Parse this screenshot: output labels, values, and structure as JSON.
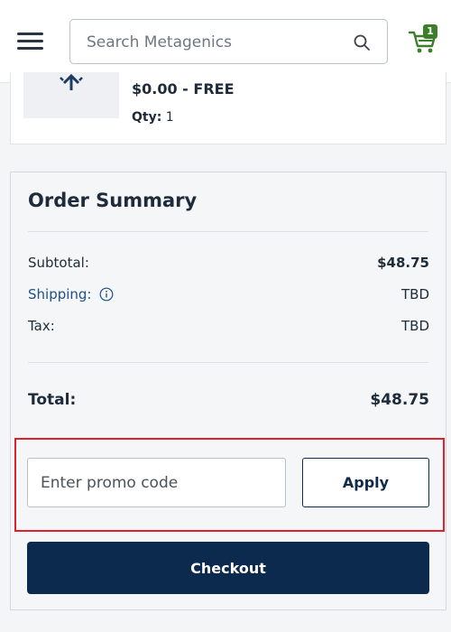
{
  "header": {
    "search_placeholder": "Search Metagenics",
    "cart_count": "1"
  },
  "product": {
    "price": "$0.00 - FREE",
    "qty_label": "Qty:",
    "qty_value": "1"
  },
  "summary": {
    "title": "Order Summary",
    "subtotal_label": "Subtotal:",
    "subtotal_value": "$48.75",
    "shipping_label": "Shipping:",
    "shipping_value": "TBD",
    "tax_label": "Tax:",
    "tax_value": "TBD",
    "total_label": "Total:",
    "total_value": "$48.75"
  },
  "promo": {
    "placeholder": "Enter promo code",
    "apply_label": "Apply"
  },
  "checkout_label": "Checkout",
  "colors": {
    "brand_navy": "#0c2a4d",
    "cart_badge_green": "#3d7e2a",
    "highlight_red": "#e0202a",
    "link_blue": "#1d4f8a"
  }
}
